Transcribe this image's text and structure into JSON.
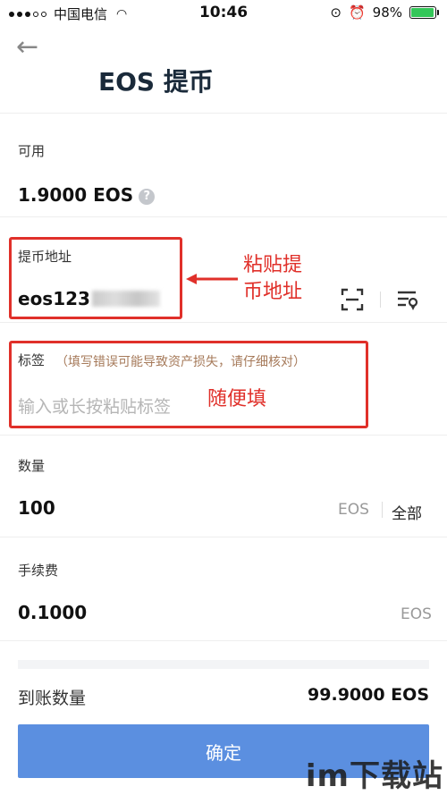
{
  "status": {
    "carrier": "中国电信",
    "time": "10:46",
    "battery": "98%",
    "battery_level": 0.98,
    "battery_color": "#34c759"
  },
  "header": {
    "back_icon": "arrow-left-icon",
    "title": "EOS 提币"
  },
  "available": {
    "label": "可用",
    "value": "1.9000 EOS",
    "help_glyph": "?"
  },
  "address": {
    "label": "提币地址",
    "value_prefix": "eos123",
    "scan_icon": "scan-icon",
    "book_icon": "address-book-icon"
  },
  "memo": {
    "label": "标签",
    "hint": "（填写错误可能导致资产损失，请仔细核对）",
    "placeholder": "输入或长按粘贴标签"
  },
  "amount": {
    "label": "数量",
    "value": "100",
    "unit": "EOS",
    "all_label": "全部"
  },
  "fee": {
    "label": "手续费",
    "value": "0.1000",
    "unit": "EOS"
  },
  "receive": {
    "label": "到账数量",
    "value": "99.9000 EOS"
  },
  "confirm_label": "确定",
  "annotations": {
    "paste_address": "粘贴提币地址",
    "paste_line1": "粘贴提",
    "paste_line2": "币地址",
    "memo_note": "随便填"
  },
  "watermark": "im下载站",
  "colors": {
    "accent": "#5b8fe0",
    "annotation": "#e0302a"
  }
}
